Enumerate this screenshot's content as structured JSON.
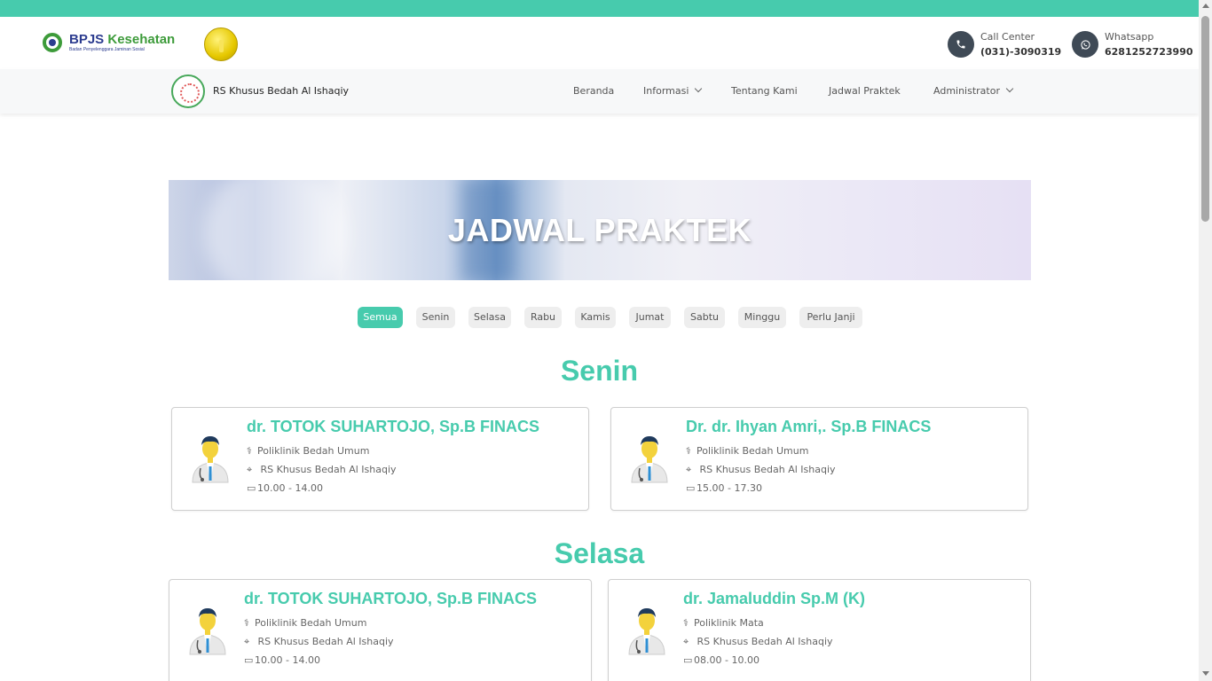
{
  "header": {
    "bpjs_brand_a": "BPJS",
    "bpjs_brand_b": " Kesehatan",
    "bpjs_tagline": "Badan Penyelenggara Jaminan Sosial",
    "call_center_label": "Call Center",
    "call_center_number": "(031)-3090319",
    "whatsapp_label": "Whatsapp",
    "whatsapp_number": "6281252723990"
  },
  "navbar": {
    "hospital_name": "RS Khusus Bedah Al Ishaqiy",
    "items": [
      {
        "label": "Beranda"
      },
      {
        "label": "Informasi"
      },
      {
        "label": "Tentang Kami"
      },
      {
        "label": "Jadwal Praktek"
      },
      {
        "label": "Administrator"
      }
    ]
  },
  "banner": {
    "title": "JADWAL PRAKTEK"
  },
  "filters": [
    "Semua",
    "Senin",
    "Selasa",
    "Rabu",
    "Kamis",
    "Jumat",
    "Sabtu",
    "Minggu",
    "Perlu Janji"
  ],
  "active_filter": "Semua",
  "schedule": [
    {
      "day": "Senin",
      "doctors": [
        {
          "name": "dr. TOTOK SUHARTOJO, Sp.B FINACS",
          "clinic": "Poliklinik Bedah Umum",
          "location": "RS Khusus Bedah Al Ishaqiy",
          "time": "10.00 - 14.00"
        },
        {
          "name": "Dr. dr. Ihyan Amri,. Sp.B FINACS",
          "clinic": "Poliklinik Bedah Umum",
          "location": "RS Khusus Bedah Al Ishaqiy",
          "time": "15.00 - 17.30"
        }
      ]
    },
    {
      "day": "Selasa",
      "doctors": [
        {
          "name": "dr. TOTOK SUHARTOJO, Sp.B FINACS",
          "clinic": "Poliklinik Bedah Umum",
          "location": "RS Khusus Bedah Al Ishaqiy",
          "time": "10.00 - 14.00"
        },
        {
          "name": "dr. Jamaluddin Sp.M (K)",
          "clinic": "Poliklinik Mata",
          "location": "RS Khusus Bedah Al Ishaqiy",
          "time": "08.00 - 10.00"
        }
      ]
    }
  ],
  "colors": {
    "accent": "#47cbad",
    "icon_circle": "#3f4a56"
  },
  "icons": {
    "phone": "phone-icon",
    "whatsapp": "whatsapp-icon",
    "clinic": "stethoscope-icon",
    "location": "map-pin-icon",
    "time": "calendar-icon"
  }
}
